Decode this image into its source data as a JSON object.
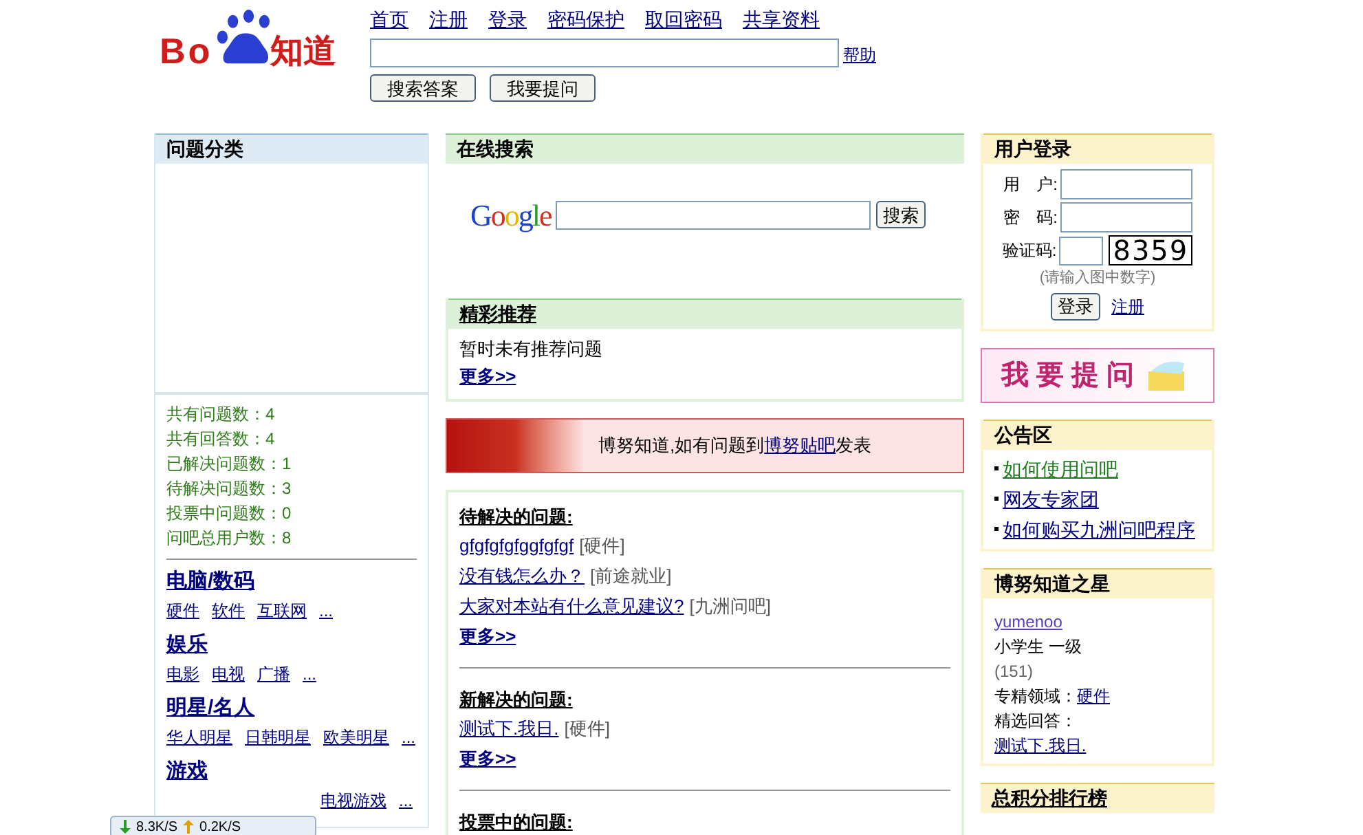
{
  "logo": {
    "left": "Bo",
    "right": "知道"
  },
  "header": {
    "nav_links": [
      "首页",
      "注册",
      "登录",
      "密码保护",
      "取回密码",
      "共享资料"
    ],
    "help_link": "帮助",
    "buttons": [
      "搜索答案",
      "我要提问"
    ]
  },
  "left": {
    "title": "问题分类",
    "stats": [
      {
        "label": "共有问题数：",
        "value": "4"
      },
      {
        "label": "共有回答数：",
        "value": "4"
      },
      {
        "label": "已解决问题数：",
        "value": "1"
      },
      {
        "label": "待解决问题数：",
        "value": "3"
      },
      {
        "label": "投票中问题数：",
        "value": "0"
      },
      {
        "label": "问吧总用户数：",
        "value": "8"
      }
    ],
    "categories": [
      {
        "name": "电脑/数码",
        "subs": [
          "硬件",
          "软件",
          "互联网",
          "..."
        ]
      },
      {
        "name": "娱乐",
        "subs": [
          "电影",
          "电视",
          "广播",
          "..."
        ]
      },
      {
        "name": "明星/名人",
        "subs": [
          "华人明星",
          "日韩明星",
          "欧美明星",
          "..."
        ]
      },
      {
        "name": "游戏",
        "subs": [
          "电视游戏",
          "..."
        ]
      }
    ]
  },
  "online_search": {
    "title": "在线搜索",
    "logo": "Google",
    "button": "搜索"
  },
  "featured": {
    "title": "精彩推荐",
    "message": "暂时未有推荐问题",
    "more": "更多>>"
  },
  "banner": {
    "text": "博努知道,如有问题到",
    "link": "博努贴吧",
    "suffix": "发表"
  },
  "questions": [
    {
      "title": "待解决的问题:",
      "items": [
        {
          "title": "gfgfgfgfggfgfgf",
          "category": "[硬件]"
        },
        {
          "title": "没有钱怎么办？",
          "category": "[前途就业]"
        },
        {
          "title": "大家对本站有什么意见建议?",
          "category": "[九洲问吧]"
        }
      ],
      "more": "更多>>"
    },
    {
      "title": "新解决的问题:",
      "items": [
        {
          "title": "测试下.我日.",
          "category": "[硬件]"
        }
      ],
      "more": "更多>>"
    },
    {
      "title": "投票中的问题:"
    }
  ],
  "login": {
    "title": "用户登录",
    "fields": [
      "用　户:",
      "密　码:"
    ],
    "captcha_label": "验证码:",
    "captcha": "8359",
    "hint": "(请输入图中数字)",
    "button": "登录",
    "register": "注册"
  },
  "ask_banner": {
    "text": "我 要 提 问"
  },
  "notices": {
    "title": "公告区",
    "items": [
      {
        "text": "如何使用问吧",
        "visited": true
      },
      {
        "text": "网友专家团",
        "visited": false
      },
      {
        "text": "如何购买九洲问吧程序",
        "visited": false
      }
    ]
  },
  "star": {
    "title": "博努知道之星",
    "user": "yumenoo",
    "rank": "小学生 一级",
    "points": "(151)",
    "field_label": "专精领域：",
    "field_link": "硬件",
    "answer_label": "精选回答：",
    "answer_link": "测试下.我日."
  },
  "ranking": {
    "title": "总积分排行榜"
  },
  "download_widget": {
    "down": "8.3K/S",
    "up": "0.2K/S"
  }
}
